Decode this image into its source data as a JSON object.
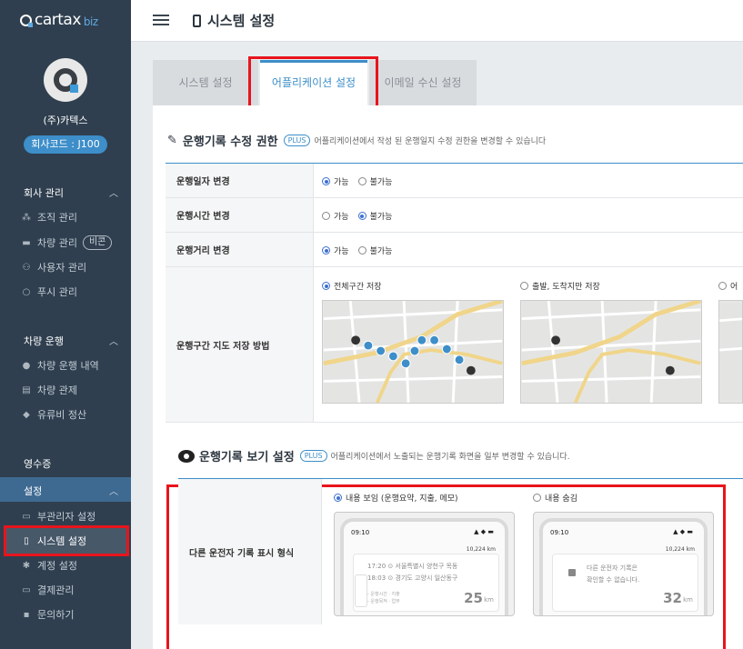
{
  "brand": {
    "logo_text": "cartax",
    "logo_suffix": "biz"
  },
  "company": {
    "name": "(주)카텍스",
    "code": "회사코드 : J100"
  },
  "sidebar": {
    "sections": [
      {
        "title": "회사 관리",
        "items": [
          {
            "label": "조직 관리",
            "icon": "org-icon"
          },
          {
            "label": "차량 관리",
            "icon": "car-icon",
            "badge": "비콘"
          },
          {
            "label": "사용자 관리",
            "icon": "users-icon"
          },
          {
            "label": "푸시 관리",
            "icon": "chat-icon"
          }
        ]
      },
      {
        "title": "차량 운행",
        "items": [
          {
            "label": "차량 운행 내역",
            "icon": "pin-icon"
          },
          {
            "label": "차량 관제",
            "icon": "map-icon"
          },
          {
            "label": "유류비 정산",
            "icon": "drop-icon"
          }
        ]
      },
      {
        "title": "영수증",
        "items": []
      },
      {
        "title": "설정",
        "items": [
          {
            "label": "부관리자 설정",
            "icon": "monitor-icon"
          },
          {
            "label": "시스템 설정",
            "icon": "phone-icon"
          },
          {
            "label": "계정 설정",
            "icon": "gear-icon"
          },
          {
            "label": "결제관리",
            "icon": "card-icon"
          },
          {
            "label": "문의하기",
            "icon": "message-icon"
          }
        ]
      }
    ]
  },
  "header": {
    "title": "시스템 설정"
  },
  "tabs": [
    "시스템 설정",
    "어플리케이션 설정",
    "이메일 수신 설정"
  ],
  "section1": {
    "title": "운행기록 수정 권한",
    "plus": "PLUS",
    "desc": "어플리케이션에서 작성 된 운행일지 수정 권한을 변경할 수 있습니다",
    "rows": [
      {
        "label": "운행일자 변경",
        "options": [
          "가능",
          "불가능"
        ],
        "selected": 0
      },
      {
        "label": "운행시간 변경",
        "options": [
          "가능",
          "불가능"
        ],
        "selected": 1
      },
      {
        "label": "운행거리 변경",
        "options": [
          "가능",
          "불가능"
        ],
        "selected": 0
      }
    ],
    "map_row": {
      "label": "운행구간 지도 저장 방법",
      "options": [
        "전체구간 저장",
        "출발, 도착지만 저장",
        "어"
      ],
      "selected": 0
    }
  },
  "section2": {
    "title": "운행기록 보기 설정",
    "plus": "PLUS",
    "desc": "어플리케이션에서 노출되는 운행기록 화면을 일부 변경할 수 있습니다.",
    "row_label": "다른 운전자 기록 표시 형식",
    "options": [
      "내용 보임 (운행요약, 지출, 메모)",
      "내용 숨김"
    ],
    "selected": 0,
    "preview_shown": {
      "time": "09:10",
      "km_top": "10,224 km",
      "start_time": "17:20",
      "start_addr": "서울특별시 양천구 목동",
      "end_time": "18:03",
      "end_addr": "경기도 고양시 일산동구",
      "mini1": "- 운행시간 · 지출",
      "mini2": "- 운행목적 · 업무",
      "distance": "25",
      "unit": "km"
    },
    "preview_hidden": {
      "time": "09:10",
      "km_top": "10,224 km",
      "hidden_line1": "다른 운전자 기록은",
      "hidden_line2": "확인할 수 없습니다.",
      "distance": "32",
      "unit": "km"
    }
  }
}
